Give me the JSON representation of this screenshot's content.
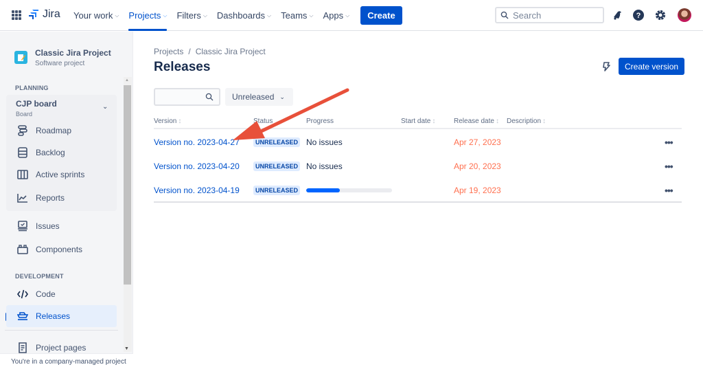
{
  "topnav": {
    "app_name": "Jira",
    "items": [
      {
        "label": "Your work",
        "active": false
      },
      {
        "label": "Projects",
        "active": true
      },
      {
        "label": "Filters",
        "active": false
      },
      {
        "label": "Dashboards",
        "active": false
      },
      {
        "label": "Teams",
        "active": false
      },
      {
        "label": "Apps",
        "active": false
      }
    ],
    "create_label": "Create",
    "search_placeholder": "Search",
    "icons": [
      "notifications-icon",
      "help-icon",
      "settings-icon",
      "avatar"
    ]
  },
  "sidebar": {
    "project_name": "Classic Jira Project",
    "project_type": "Software project",
    "planning_label": "PLANNING",
    "board_name": "CJP board",
    "board_sub": "Board",
    "planning_items": [
      {
        "label": "Roadmap",
        "icon": "roadmap-icon"
      },
      {
        "label": "Backlog",
        "icon": "backlog-icon"
      },
      {
        "label": "Active sprints",
        "icon": "active-sprints-icon"
      },
      {
        "label": "Reports",
        "icon": "reports-icon"
      }
    ],
    "other_items": [
      {
        "label": "Issues",
        "icon": "issues-icon"
      },
      {
        "label": "Components",
        "icon": "components-icon"
      }
    ],
    "development_label": "DEVELOPMENT",
    "development_items": [
      {
        "label": "Code",
        "icon": "code-icon"
      },
      {
        "label": "Releases",
        "icon": "releases-icon",
        "selected": true
      }
    ],
    "project_pages_label": "Project pages",
    "footer": "You're in a company-managed project"
  },
  "main": {
    "breadcrumb": [
      "Projects",
      "Classic Jira Project"
    ],
    "breadcrumb_sep": "/",
    "title": "Releases",
    "create_version_label": "Create version",
    "search_value": "",
    "status_filter": "Unreleased",
    "columns": [
      "Version",
      "Status",
      "Progress",
      "Start date",
      "Release date",
      "Description"
    ],
    "sort_glyph": "↕",
    "rows": [
      {
        "version": "Version no. 2023-04-27",
        "status": "UNRELEASED",
        "progress_text": "No issues",
        "progress": null,
        "start_date": "",
        "release_date": "Apr 27, 2023",
        "description": ""
      },
      {
        "version": "Version no. 2023-04-20",
        "status": "UNRELEASED",
        "progress_text": "No issues",
        "progress": null,
        "start_date": "",
        "release_date": "Apr 20, 2023",
        "description": ""
      },
      {
        "version": "Version no. 2023-04-19",
        "status": "UNRELEASED",
        "progress_text": "",
        "progress": 0.39,
        "start_date": "",
        "release_date": "Apr 19, 2023",
        "description": ""
      }
    ],
    "more_glyph": "•••"
  },
  "colors": {
    "accent": "#0052cc",
    "overdue_date": "#ff5630",
    "lozenge_bg": "#deebff",
    "progress_done": "#0065ff",
    "annotation_arrow": "#e8503a"
  }
}
